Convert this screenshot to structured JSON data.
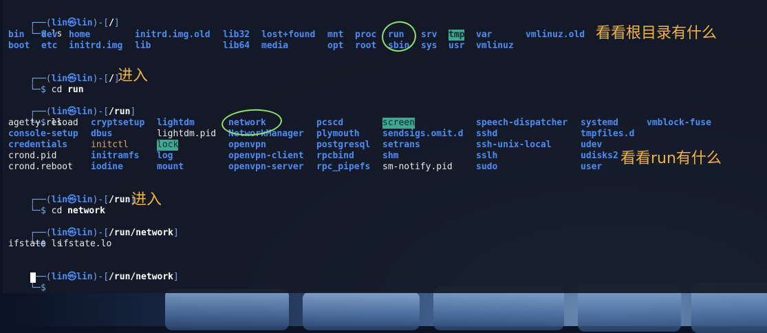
{
  "colors": {
    "annotation": "#f0b43a",
    "directory": "#4a8df7",
    "highlight_bg": "#3fa792",
    "circle": "#8fe36a"
  },
  "terminal": {
    "p1": {
      "user": "lin",
      "at": "㉿",
      "host": "lin",
      "path": "/",
      "cmd": "ls"
    },
    "root_listing": {
      "row1": [
        "bin",
        "dev",
        "home",
        "initrd.img.old",
        "lib32",
        "lost+found",
        "mnt",
        "proc",
        "run",
        "srv",
        "tmp",
        "var",
        "vmlinuz.old"
      ],
      "row2": [
        "boot",
        "etc",
        "initrd.img",
        "lib",
        "lib64",
        "media",
        "opt",
        "root",
        "sbin",
        "sys",
        "usr",
        "vmlinuz"
      ]
    },
    "p2": {
      "user": "lin",
      "at": "㉿",
      "host": "lin",
      "path": "/",
      "cmd_prefix": "cd",
      "cmd_arg": "run"
    },
    "p3": {
      "user": "lin",
      "at": "㉿",
      "host": "lin",
      "path": "/run",
      "cmd": "ls"
    },
    "run_listing": {
      "col1": [
        "agetty.reload",
        "console-setup",
        "credentials",
        "crond.pid",
        "crond.reboot"
      ],
      "col2": [
        "cryptsetup",
        "dbus",
        "initctl",
        "initramfs",
        "iodine"
      ],
      "col3": [
        "lightdm",
        "lightdm.pid",
        "lock",
        "log",
        "mount"
      ],
      "col4": [
        "network",
        "NetworkManager",
        "openvpn",
        "openvpn-client",
        "openvpn-server"
      ],
      "col5": [
        "pcscd",
        "plymouth",
        "postgresql",
        "rpcbind",
        "rpc_pipefs"
      ],
      "col6": [
        "screen",
        "sendsigs.omit.d",
        "setrans",
        "shm",
        "sm-notify.pid"
      ],
      "col7": [
        "speech-dispatcher",
        "sshd",
        "ssh-unix-local",
        "sslh",
        "sudo"
      ],
      "col8": [
        "systemd",
        "tmpfiles.d",
        "udev",
        "udisks2",
        "user"
      ],
      "col9": [
        "vmblock-fuse"
      ]
    },
    "p4": {
      "user": "lin",
      "at": "㉿",
      "host": "lin",
      "path": "/run",
      "cmd_prefix": "cd",
      "cmd_arg": "network"
    },
    "p5": {
      "user": "lin",
      "at": "㉿",
      "host": "lin",
      "path": "/run/network",
      "cmd": "ls"
    },
    "network_listing": [
      "ifstate",
      "ifstate.lo"
    ],
    "p6": {
      "user": "lin",
      "at": "㉿",
      "host": "lin",
      "path": "/run/network"
    },
    "prompt_top_prefix": "┌──(",
    "prompt_bottom": "└─$"
  },
  "annotations": {
    "root": "看看根目录有什么",
    "enter1": "进入",
    "run": "看看run有什么",
    "enter2": "进入"
  }
}
